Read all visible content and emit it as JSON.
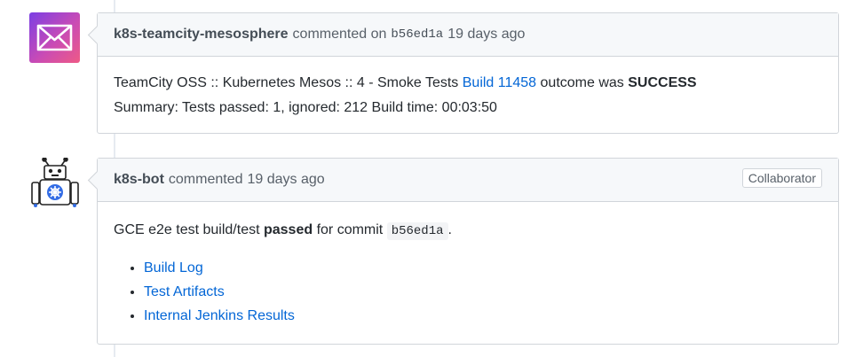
{
  "comments": [
    {
      "author": "k8s-teamcity-mesosphere",
      "verb": "commented on",
      "sha": "b56ed1a",
      "time": "19 days ago",
      "body_line1_prefix": "TeamCity OSS :: Kubernetes Mesos :: 4 - Smoke Tests ",
      "build_link": "Build 11458",
      "body_line1_mid": " outcome was ",
      "outcome": "SUCCESS",
      "body_line2": "Summary: Tests passed: 1, ignored: 212 Build time: 00:03:50",
      "avatar_icon": "envelope-logo-icon",
      "avatar_colors": [
        "#7b3fe4",
        "#e84f8a"
      ]
    },
    {
      "author": "k8s-bot",
      "verb": "commented",
      "time": "19 days ago",
      "badge": "Collaborator",
      "text_prefix": "GCE e2e test build/test ",
      "passed": "passed",
      "text_mid": " for commit ",
      "commit": "b56ed1a",
      "text_suffix": ".",
      "links": [
        "Build Log",
        "Test Artifacts",
        "Internal Jenkins Results"
      ],
      "avatar_icon": "robot-icon"
    }
  ]
}
